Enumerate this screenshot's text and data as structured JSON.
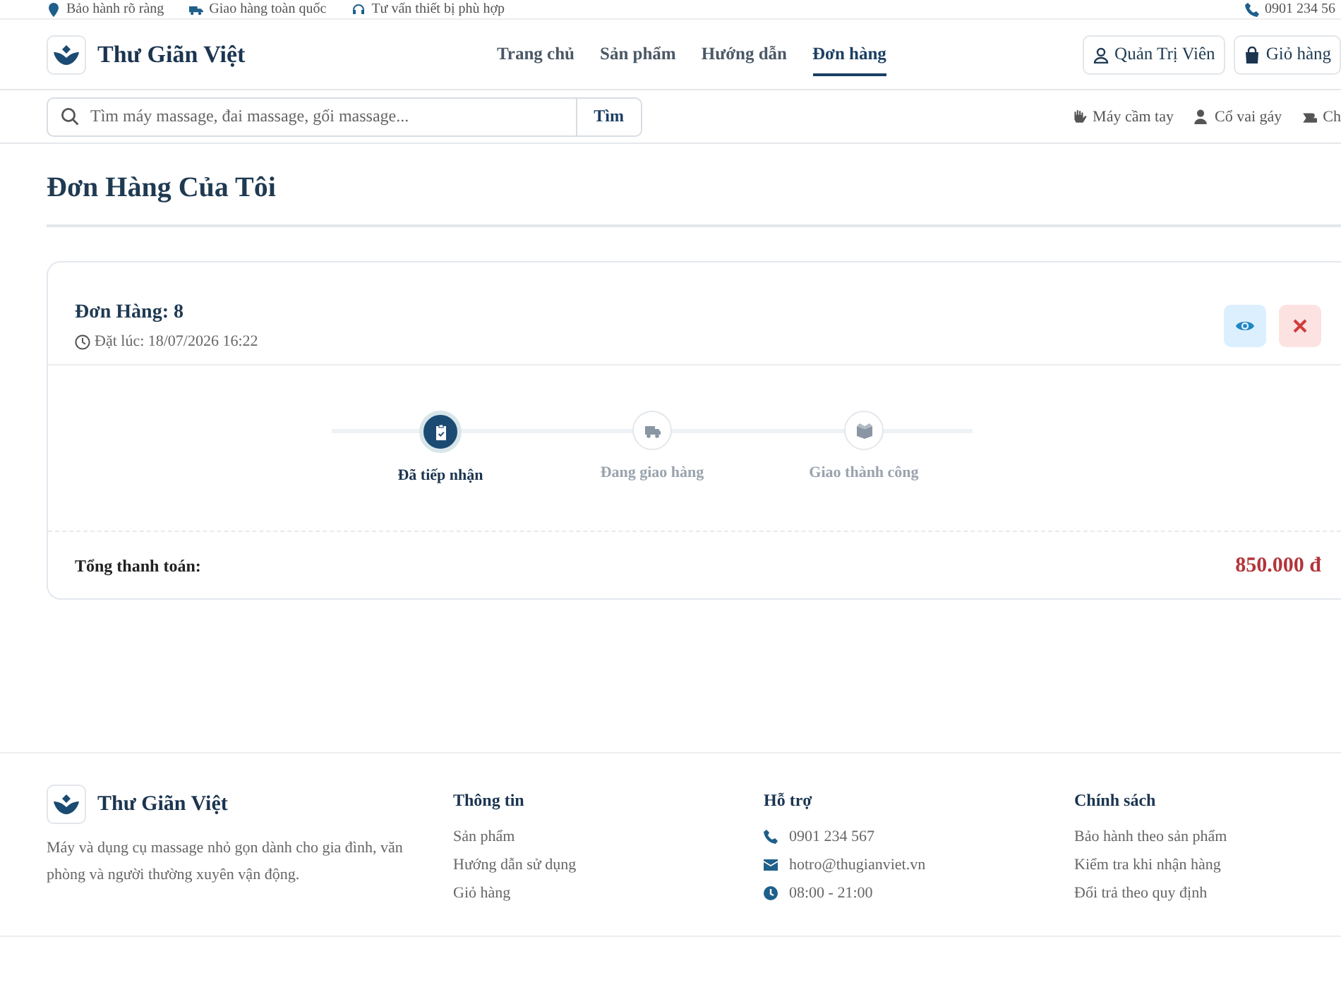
{
  "top_bar": {
    "items": [
      "Bảo hành rõ ràng",
      "Giao hàng toàn quốc",
      "Tư vấn thiết bị phù hợp"
    ],
    "phone": "0901 234 56"
  },
  "header": {
    "brand": "Thư Giãn Việt",
    "nav": [
      {
        "label": "Trang chủ",
        "selected": false
      },
      {
        "label": "Sản phẩm",
        "selected": false
      },
      {
        "label": "Hướng dẫn",
        "selected": false
      },
      {
        "label": "Đơn hàng",
        "selected": true
      }
    ],
    "buttons": [
      "Quản Trị Viên",
      "Giỏ hàng"
    ]
  },
  "search": {
    "placeholder": "Tìm máy massage, đai massage, gối massage...",
    "button": "Tìm",
    "categories": [
      "Máy cầm tay",
      "Cổ vai gáy",
      "Ch"
    ]
  },
  "page_title": "Đơn Hàng Của Tôi",
  "order": {
    "title": "Đơn Hàng: 8",
    "placed_at": "Đặt lúc: 18/07/2026 16:22",
    "steps": [
      {
        "label": "Đã tiếp nhận",
        "selected": true
      },
      {
        "label": "Đang giao hàng",
        "selected": false
      },
      {
        "label": "Giao thành công",
        "selected": false
      }
    ],
    "total_label": "Tổng thanh toán:",
    "total": "850.000 đ"
  },
  "footer": {
    "brand": "Thư Giãn Việt",
    "description": "Máy và dụng cụ massage nhỏ gọn dành cho gia đình, văn phòng và người thường xuyên vận động.",
    "columns": [
      {
        "title": "Thông tin",
        "kind": "links",
        "items": [
          "Sản phẩm",
          "Hướng dẫn sử dụng",
          "Giỏ hàng"
        ]
      },
      {
        "title": "Hỗ trợ",
        "kind": "contacts",
        "items": [
          "0901 234 567",
          "hotro@thugianviet.vn",
          "08:00 - 21:00"
        ]
      },
      {
        "title": "Chính sách",
        "kind": "links",
        "items": [
          "Bảo hành theo sản phẩm",
          "Kiểm tra khi nhận hàng",
          "Đổi trả theo quy định"
        ]
      }
    ]
  }
}
